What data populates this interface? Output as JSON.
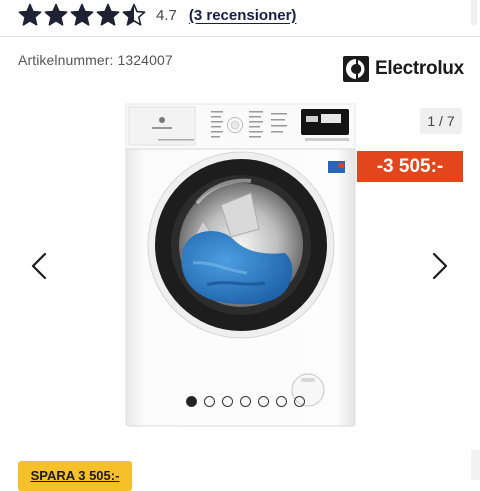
{
  "rating": {
    "value": "4.7",
    "stars_filled": 4.5,
    "stars_total": 5,
    "reviews_label": "(3 recensioner)"
  },
  "product": {
    "article_number": "Artikelnummer: 1324007",
    "brand": "Electrolux"
  },
  "gallery": {
    "counter": "1 / 7",
    "total": 7,
    "active_index": 0
  },
  "discount": {
    "label": "-3 505:-"
  },
  "save_badge": {
    "label": "SPARA 3 505:-"
  },
  "colors": {
    "star": "#1f2233",
    "discount_bg": "#e3461b",
    "save_bg": "#f6c02a",
    "link": "#1a1d4a"
  },
  "icons": {
    "prev": "chevron-left-icon",
    "next": "chevron-right-icon",
    "brand_logo": "electrolux-logo-icon"
  }
}
